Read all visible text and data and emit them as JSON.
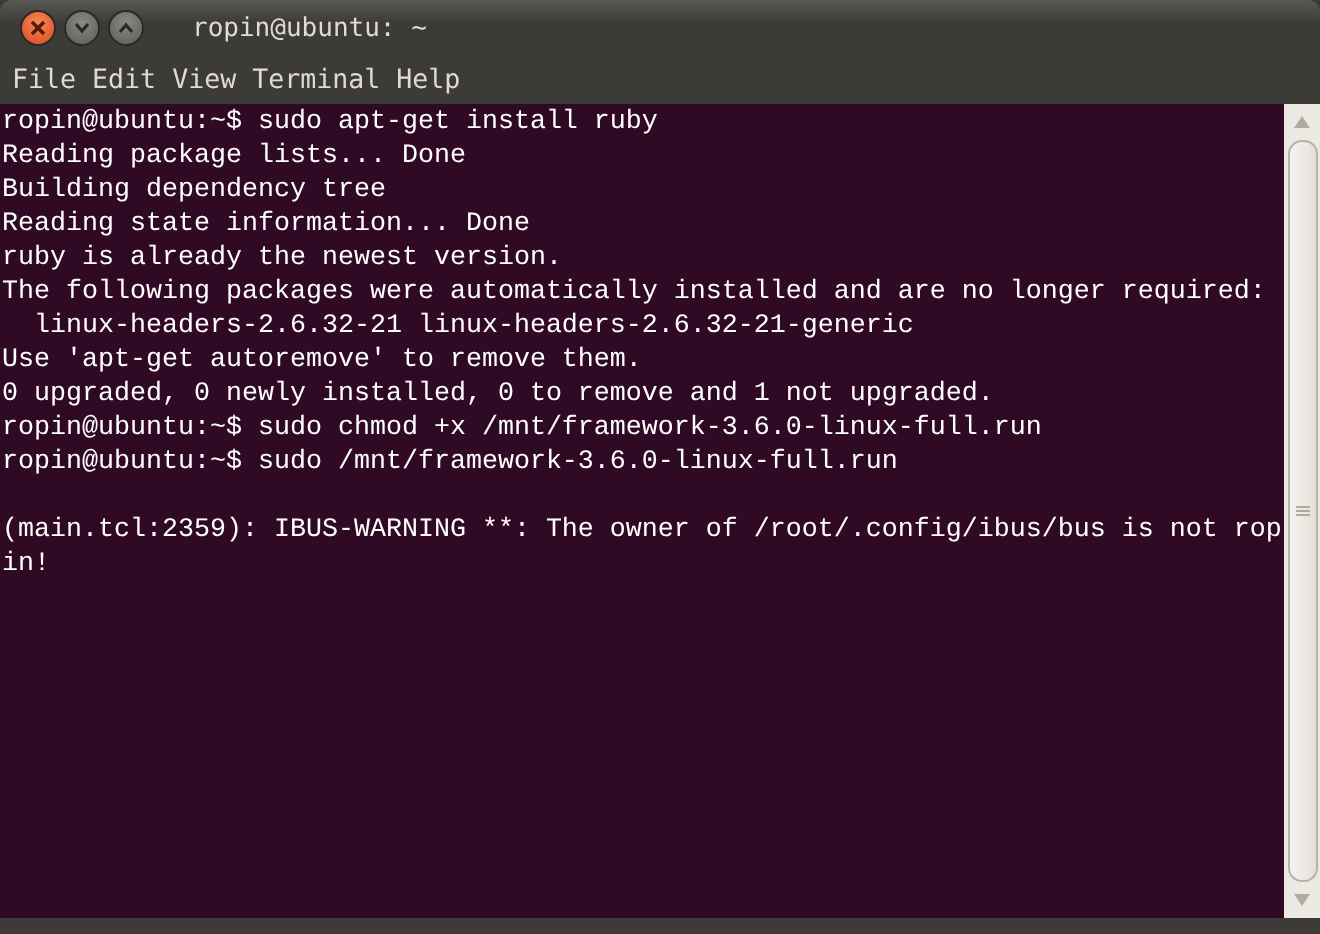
{
  "window": {
    "title": "ropin@ubuntu: ~"
  },
  "menu": [
    "File",
    "Edit",
    "View",
    "Terminal",
    "Help"
  ],
  "terminal": {
    "lines": [
      {
        "kind": "text",
        "text": "ropin@ubuntu:~$ sudo apt-get install ruby"
      },
      {
        "kind": "text",
        "text": "Reading package lists... Done"
      },
      {
        "kind": "text",
        "text": "Building dependency tree"
      },
      {
        "kind": "text",
        "text": "Reading state information... Done"
      },
      {
        "kind": "text",
        "text": "ruby is already the newest version."
      },
      {
        "kind": "text",
        "text": "The following packages were automatically installed and are no longer required:"
      },
      {
        "kind": "text",
        "text": "  linux-headers-2.6.32-21 linux-headers-2.6.32-21-generic"
      },
      {
        "kind": "text",
        "text": "Use 'apt-get autoremove' to remove them."
      },
      {
        "kind": "text",
        "text": "0 upgraded, 0 newly installed, 0 to remove and 1 not upgraded."
      },
      {
        "kind": "text",
        "text": "ropin@ubuntu:~$ sudo chmod +x /mnt/framework-3.6.0-linux-full.run"
      },
      {
        "kind": "text",
        "text": "ropin@ubuntu:~$ sudo /mnt/framework-3.6.0-linux-full.run"
      },
      {
        "kind": "blank"
      },
      {
        "kind": "text",
        "text": "(main.tcl:2359): IBUS-WARNING **: The owner of /root/.config/ibus/bus is not rop"
      },
      {
        "kind": "text",
        "text": "in!"
      }
    ]
  }
}
